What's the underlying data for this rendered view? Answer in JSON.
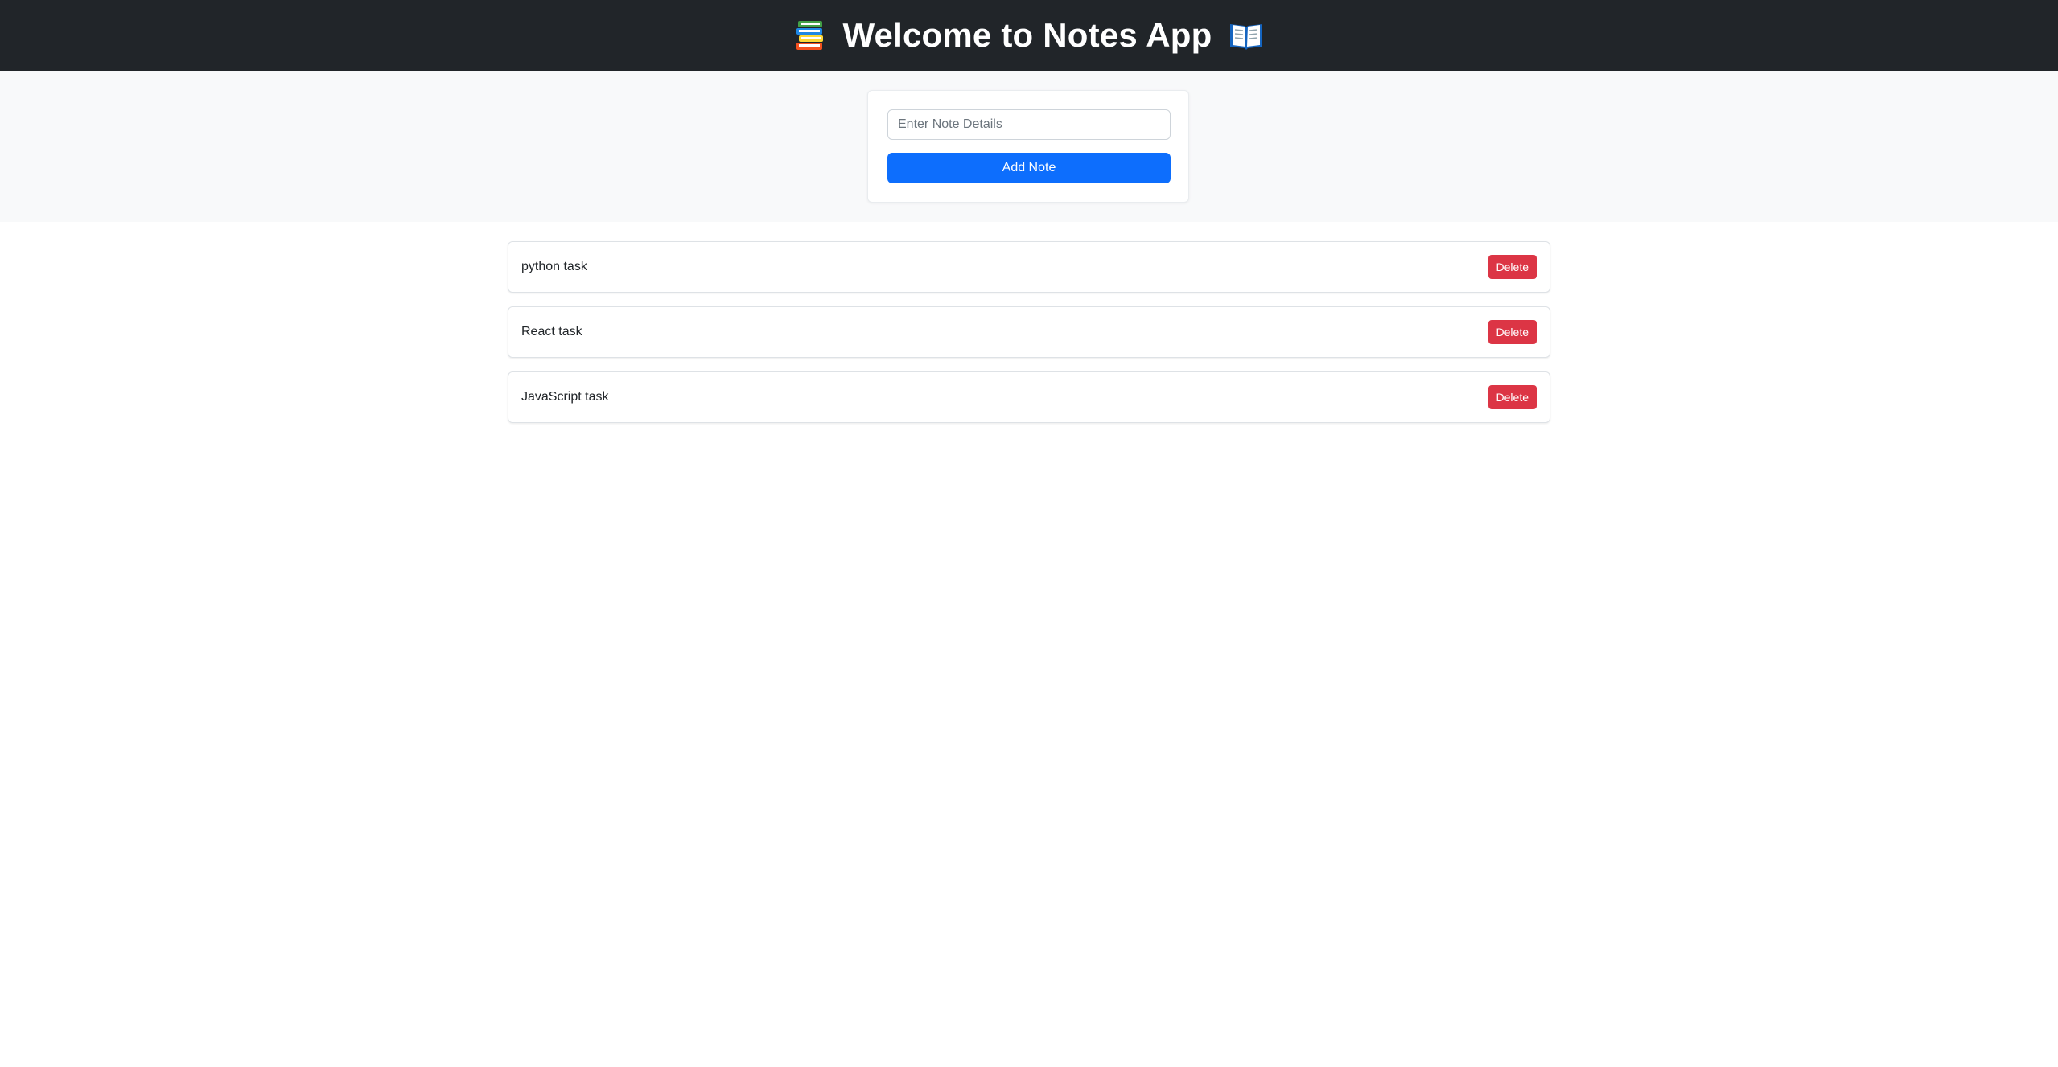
{
  "header": {
    "title": "Welcome to Notes App",
    "left_icon": "books-icon",
    "right_icon": "open-book-icon",
    "background": "#212529"
  },
  "form": {
    "input_placeholder": "Enter Note Details",
    "input_value": "",
    "add_label": "Add Note",
    "add_color": "#0d6efd"
  },
  "notes": [
    {
      "text": "python task",
      "delete_label": "Delete"
    },
    {
      "text": "React task",
      "delete_label": "Delete"
    },
    {
      "text": "JavaScript task",
      "delete_label": "Delete"
    }
  ],
  "colors": {
    "delete": "#dc3545",
    "hero_bg": "#f8f9fa"
  }
}
